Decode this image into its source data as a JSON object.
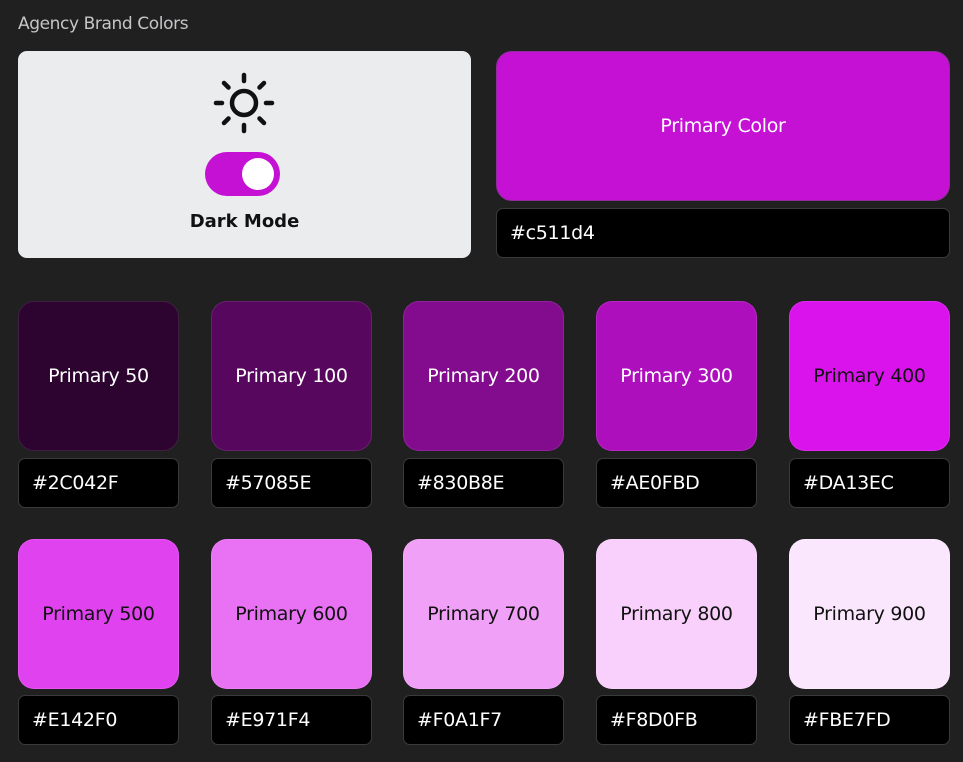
{
  "page": {
    "title": "Agency Brand Colors"
  },
  "mode_card": {
    "label": "Dark Mode",
    "icon": "sun-icon",
    "toggle_on": true
  },
  "primary": {
    "label": "Primary Color",
    "hex": "#c511d4",
    "color": "#c511d4"
  },
  "shades": [
    {
      "label": "Primary 50",
      "hex": "#2C042F",
      "color": "#2c042f",
      "text_color": "#ffffff"
    },
    {
      "label": "Primary 100",
      "hex": "#57085E",
      "color": "#57085e",
      "text_color": "#ffffff"
    },
    {
      "label": "Primary 200",
      "hex": "#830B8E",
      "color": "#830b8e",
      "text_color": "#ffffff"
    },
    {
      "label": "Primary 300",
      "hex": "#AE0FBD",
      "color": "#ae0fbd",
      "text_color": "#ffffff"
    },
    {
      "label": "Primary 400",
      "hex": "#DA13EC",
      "color": "#da13ec",
      "text_color": "#111111"
    },
    {
      "label": "Primary 500",
      "hex": "#E142F0",
      "color": "#e142f0",
      "text_color": "#111111"
    },
    {
      "label": "Primary 600",
      "hex": "#E971F4",
      "color": "#e971f4",
      "text_color": "#111111"
    },
    {
      "label": "Primary 700",
      "hex": "#F0A1F7",
      "color": "#f0a1f7",
      "text_color": "#111111"
    },
    {
      "label": "Primary 800",
      "hex": "#F8D0FB",
      "color": "#f8d0fb",
      "text_color": "#111111"
    },
    {
      "label": "Primary 900",
      "hex": "#FBE7FD",
      "color": "#fbe7fd",
      "text_color": "#111111"
    }
  ]
}
